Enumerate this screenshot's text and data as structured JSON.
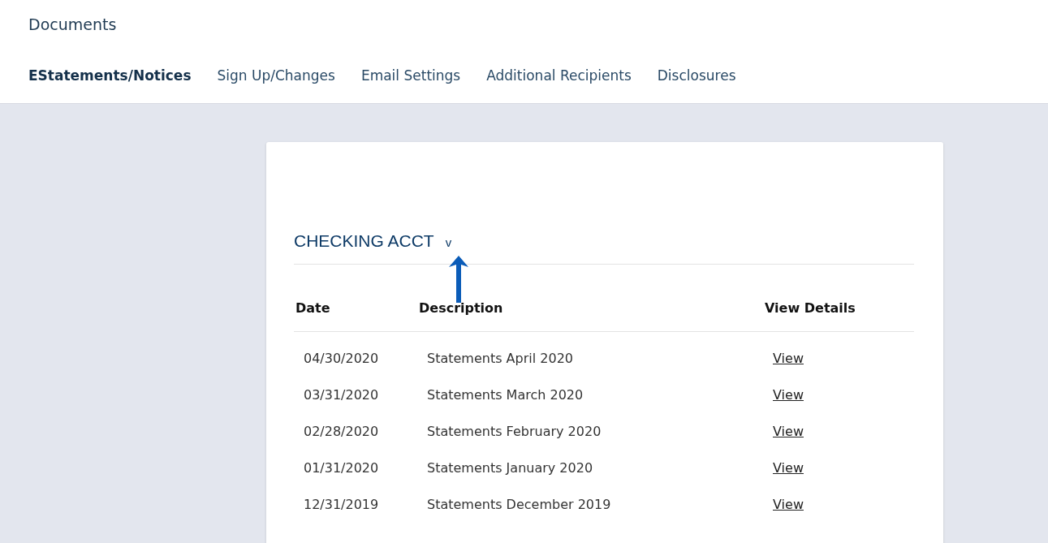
{
  "page_title": "Documents",
  "tabs": [
    {
      "label": "EStatements/Notices",
      "selected": true
    },
    {
      "label": "Sign Up/Changes",
      "selected": false
    },
    {
      "label": "Email Settings",
      "selected": false
    },
    {
      "label": "Additional Recipients",
      "selected": false
    },
    {
      "label": "Disclosures",
      "selected": false
    }
  ],
  "account": {
    "name": "CHECKING ACCT",
    "toggle": "v"
  },
  "table": {
    "columns": [
      "Date",
      "Description",
      "View Details"
    ],
    "rows": [
      {
        "date": "04/30/2020",
        "description": "Statements April 2020",
        "link": "View"
      },
      {
        "date": "03/31/2020",
        "description": "Statements March 2020",
        "link": "View"
      },
      {
        "date": "02/28/2020",
        "description": "Statements February 2020",
        "link": "View"
      },
      {
        "date": "01/31/2020",
        "description": "Statements January 2020",
        "link": "View"
      },
      {
        "date": "12/31/2019",
        "description": "Statements December 2019",
        "link": "View"
      }
    ]
  }
}
